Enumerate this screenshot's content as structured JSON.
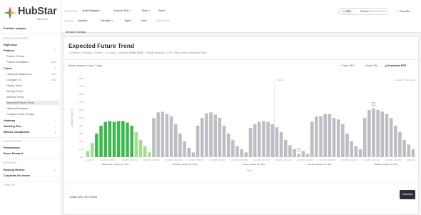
{
  "app": {
    "brand": "HubStar",
    "brand_sub": "Utilisation",
    "brand_colors": [
      "#e8443a",
      "#f4b400",
      "#1f8fd6",
      "#4ca84c"
    ]
  },
  "sidebar": {
    "portfolio": "Portfolio Insights",
    "building_label": "Building Insights",
    "right_now": "Right Now",
    "patterns": "Patterns",
    "pattern_of_use": "Pattern Of Use",
    "pattern_deviations": "Pattern Deviations",
    "beta": "BETA",
    "charts": "Charts",
    "chart_items": [
      {
        "label": "Historical Analysis v2",
        "beta": "BETA"
      },
      {
        "label": "Compare v2",
        "beta": "BETA"
      },
      {
        "label": "Hourly Trend"
      },
      {
        "label": "Weekly Trend"
      },
      {
        "label": "Monthly Trend"
      },
      {
        "label": "Expected Future Trend"
      },
      {
        "label": "Historical Analysis"
      },
      {
        "label": "Compare Zone Groups"
      }
    ],
    "heatmap": "Heatmap",
    "stacking_plan": "Stacking Plan",
    "metrics_comparison": "Metrics Comparison",
    "room_insight": "Room Insight",
    "performance": "Performance",
    "room_demand": "Room Demand",
    "bookings_label": "Bookings",
    "booking_metrics": "Booking Metrics",
    "corporate_no_shows": "Corporate No-shows",
    "timeline_label": "Timeline"
  },
  "topbar": {
    "location_label": "Location",
    "filter_label": "Filter",
    "location": [
      "Arabi-Warpark",
      "London HQ",
      "Floor",
      "Zone"
    ],
    "filters": [
      "Activity",
      "Function",
      "Type",
      "Unit",
      "Metadata"
    ],
    "data_source_label": "Data Source",
    "data_source_options": [
      "Wifi",
      "Sensor"
    ],
    "data_source_selected": "Wifi",
    "favorite": "Favorite",
    "more_settings": "More Settings"
  },
  "main": {
    "title": "Expected Future Trend",
    "subtitle_prefix": "Locations: 1 building · 3 floors · 21 zones · Capacity:",
    "subtitle_capacity": "100%, 8,053",
    "subtitle_mid": "· Default capacity: 2,138 ·",
    "subtitle_suffix": "Data format: Utilisation Rate",
    "mean_label": "Mean values per hour, 7 days",
    "peak": "Peak: 64%",
    "quiet": "Quiet: 5%",
    "download_pdf": "Download PDF",
    "analyze_csv": "Analyze CSV data",
    "download_csv": "Download CSV"
  },
  "chart_data": {
    "type": "bar",
    "ylabel": "Utilisation Rate %",
    "xlabel": "Time",
    "y_ticks": [
      "100%",
      "90%",
      "80%",
      "70%",
      "60%",
      "50%",
      "40%",
      "30%",
      "20%",
      "10%",
      "0%"
    ],
    "ylim": [
      0,
      100
    ],
    "annotations": [
      "Week 2",
      "Capacity: 2138 seats"
    ],
    "day_labels": [
      "Wednesday, January 17, 2024",
      "Thursday, January 18, 2024",
      "Friday, January 19, 2024",
      "Monday, January 22, 2024",
      "Tuesday, January 23, 2024"
    ],
    "time_labels": [
      "10:00 AM",
      "12:00 PM",
      "02:00 PM",
      "04:00 PM",
      "06:00 PM",
      "08:00 PM"
    ],
    "colors": {
      "past_dark": "#3fb94f",
      "past_light": "#a6dc92",
      "future": "#bcbec3"
    },
    "series": [
      {
        "name": "Past",
        "values": [
          8,
          18,
          30,
          40,
          45,
          46,
          45,
          46,
          46,
          44,
          40,
          32,
          22,
          14,
          6
        ]
      },
      {
        "name": "Future",
        "values": [
          50,
          57,
          58,
          55,
          52,
          42,
          30,
          20,
          12,
          6,
          40,
          50,
          56,
          57,
          54,
          50,
          40,
          30,
          22,
          14,
          10,
          6,
          37,
          42,
          45,
          46,
          45,
          42,
          38,
          32,
          22,
          15,
          10,
          4,
          8,
          4,
          45,
          52,
          52,
          55,
          55,
          50,
          48,
          42,
          30,
          20,
          14,
          10,
          50,
          60,
          62,
          60,
          58,
          55,
          50,
          40,
          32,
          22,
          16,
          10
        ]
      }
    ],
    "past_shade": [
      "light",
      "light",
      "dark",
      "dark",
      "dark",
      "dark",
      "dark",
      "dark",
      "dark",
      "dark",
      "dark",
      "light",
      "light",
      "light",
      "light"
    ],
    "markers": [
      {
        "series": "Future",
        "index": 33,
        "label": "min"
      },
      {
        "series": "Future",
        "index": 50,
        "label": "max"
      }
    ]
  }
}
